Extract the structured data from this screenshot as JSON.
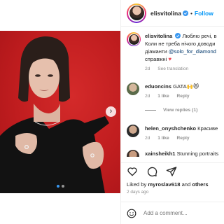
{
  "colors": {
    "accent": "#0095f6",
    "verified": "#3897f0",
    "heart": "#ed4956",
    "photo_bg": "#c01d1f"
  },
  "header": {
    "username": "elisvitolina",
    "separator": "•",
    "follow_label": "Follow"
  },
  "caption": {
    "username": "elisvitolina",
    "text_1": "Люблю речі, в",
    "text_2": "Коли не треба нічого доводи",
    "text_3": "діаманти",
    "mention": "@solo_for_diamond",
    "text_4": "справжні",
    "time": "2d",
    "see_translation": "See translation"
  },
  "comments": [
    {
      "username": "eduoncins",
      "text": "GATA🙌😻",
      "time": "2d",
      "likes": "1 like",
      "reply": "Reply"
    },
    {
      "username": "helen_onyshchenko",
      "text": "Красиве",
      "time": "2d",
      "likes": "1 like",
      "reply": "Reply"
    },
    {
      "username": "xainsheikh1",
      "text": "Stunning portraits"
    }
  ],
  "view_replies": "View replies (1)",
  "likes": {
    "prefix": "Liked by",
    "user": "myroslav618",
    "joiner": "and",
    "others": "others"
  },
  "posted": "2 days ago",
  "add_comment": {
    "placeholder": "Add a comment..."
  },
  "icons": [
    "heart-icon",
    "comment-icon",
    "share-icon",
    "emoji-icon",
    "verified-icon",
    "chevron-right-icon"
  ]
}
